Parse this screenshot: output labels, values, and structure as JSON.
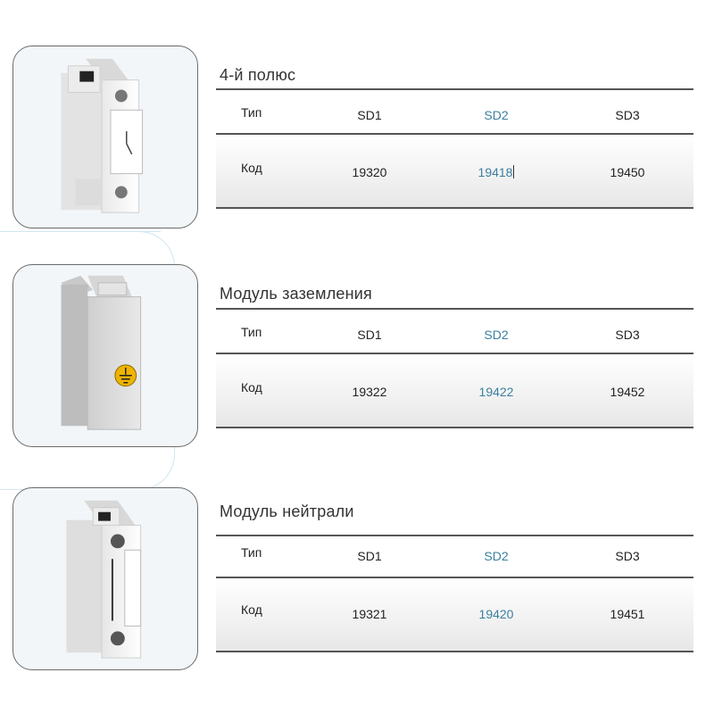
{
  "sections": [
    {
      "title": "4-й полюс",
      "row_type_label": "Тип",
      "row_code_label": "Код",
      "types": [
        "SD1",
        "SD2",
        "SD3"
      ],
      "codes": [
        "19320",
        "19418",
        "19450"
      ],
      "photo_icon": "switch-module-pole-icon"
    },
    {
      "title": "Модуль заземления",
      "row_type_label": "Тип",
      "row_code_label": "Код",
      "types": [
        "SD1",
        "SD2",
        "SD3"
      ],
      "codes": [
        "19322",
        "19422",
        "19452"
      ],
      "photo_icon": "ground-module-icon"
    },
    {
      "title": "Модуль нейтрали",
      "row_type_label": "Тип",
      "row_code_label": "Код",
      "types": [
        "SD1",
        "SD2",
        "SD3"
      ],
      "codes": [
        "19321",
        "19420",
        "19451"
      ],
      "photo_icon": "neutral-module-icon"
    }
  ],
  "colors": {
    "highlight": "#3b7fa0",
    "rule": "#555555",
    "border": "#6b6b6b"
  }
}
